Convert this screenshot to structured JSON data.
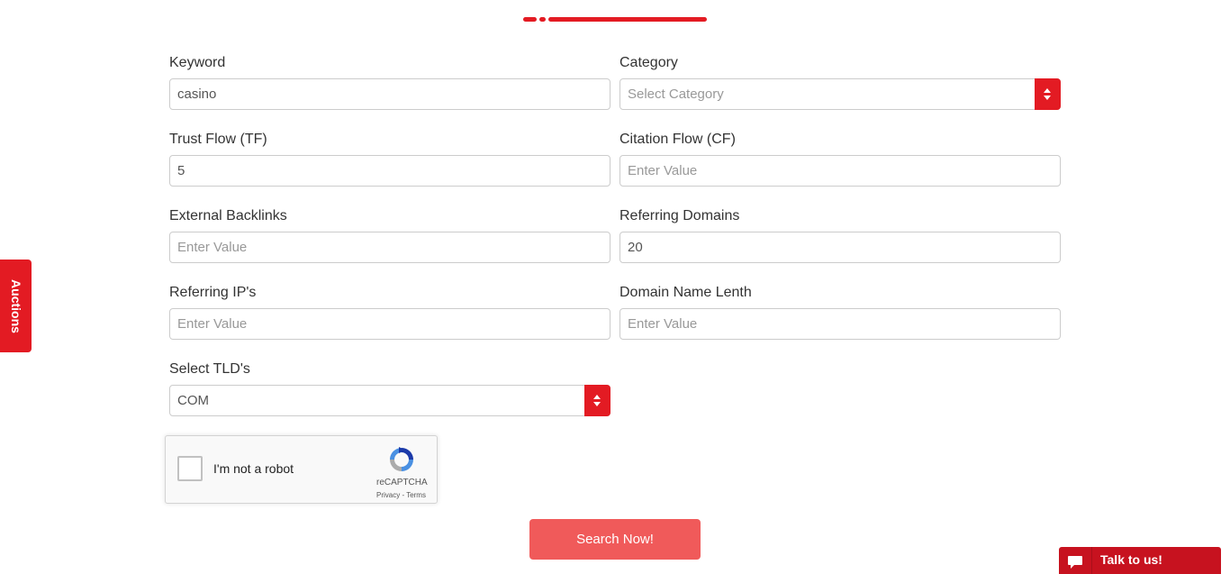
{
  "form": {
    "keyword": {
      "label": "Keyword",
      "value": "casino",
      "placeholder": ""
    },
    "category": {
      "label": "Category",
      "value": "",
      "placeholder": "Select Category"
    },
    "trust_flow": {
      "label": "Trust Flow (TF)",
      "value": "5",
      "placeholder": ""
    },
    "citation_flow": {
      "label": "Citation Flow (CF)",
      "value": "",
      "placeholder": "Enter Value"
    },
    "external_backlinks": {
      "label": "External Backlinks",
      "value": "",
      "placeholder": "Enter Value"
    },
    "referring_domains": {
      "label": "Referring Domains",
      "value": "20",
      "placeholder": ""
    },
    "referring_ips": {
      "label": "Referring IP's",
      "value": "",
      "placeholder": "Enter Value"
    },
    "domain_name_length": {
      "label": "Domain Name Lenth",
      "value": "",
      "placeholder": "Enter Value"
    },
    "tld": {
      "label": "Select TLD's",
      "value": "COM"
    }
  },
  "captcha": {
    "label": "I'm not a robot",
    "brand": "reCAPTCHA",
    "links": "Privacy - Terms"
  },
  "search_button": "Search Now!",
  "side_tab": "Auctions",
  "chat": {
    "label": "Talk to us!"
  },
  "colors": {
    "accent": "#e31b23",
    "button": "#f05a5a",
    "chat": "#c7121f"
  }
}
